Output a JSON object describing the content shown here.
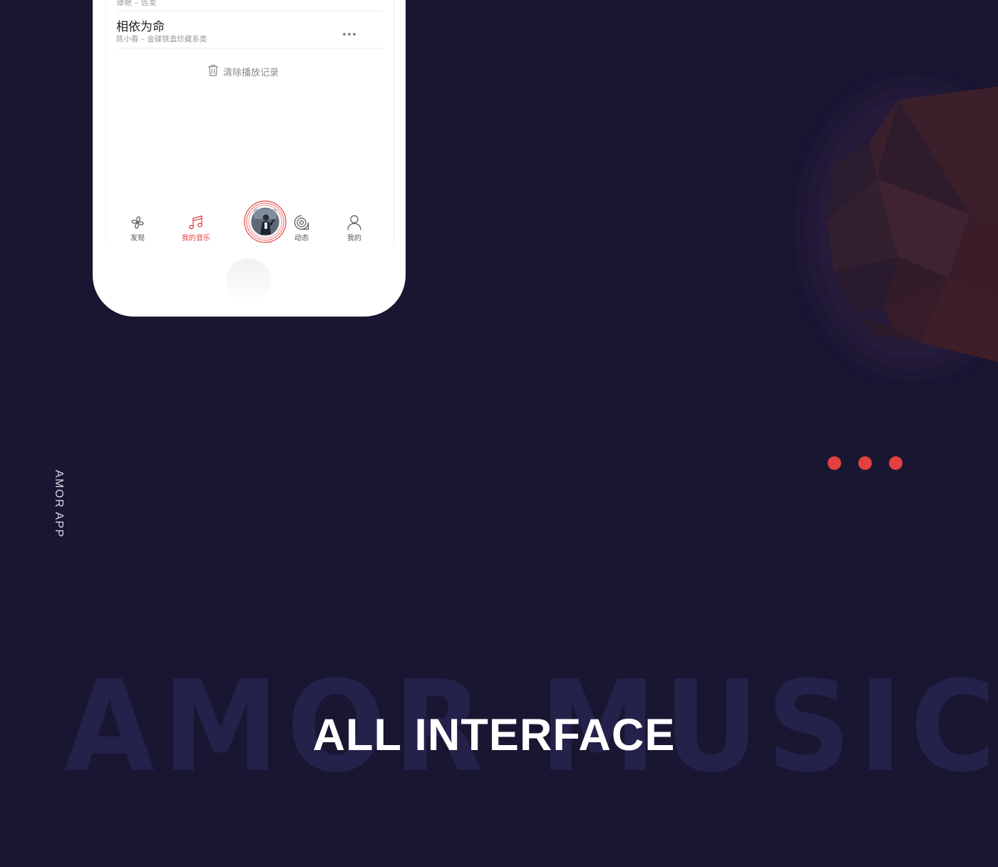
{
  "colors": {
    "background": "#191632",
    "accent": "#e3413f",
    "muted_word": "#24214b",
    "phone": "#ffffff"
  },
  "song_list": {
    "previous_item": {
      "subtitle": "谭艳 – 告发"
    },
    "current_item": {
      "title": "相依为命",
      "subtitle": "陈小春 – 金碟铁盒珍藏系类",
      "more_icon": "more-horizontal-icon"
    },
    "clear_history": {
      "icon": "trash-icon",
      "label": "清除播放记录"
    }
  },
  "tab_bar": {
    "tabs": [
      {
        "label": "发现",
        "icon": "discover-icon",
        "active": false
      },
      {
        "label": "我的音乐",
        "icon": "music-note-icon",
        "active": true
      },
      {
        "label": "动态",
        "icon": "activity-icon",
        "active": false
      },
      {
        "label": "我的",
        "icon": "user-icon",
        "active": false
      }
    ],
    "player_icon": "now-playing-disc-icon"
  },
  "decor": {
    "dots": 3,
    "side_label": "AMOR APP",
    "background_word": "AMOR MUSIC",
    "headline": "ALL INTERFACE"
  }
}
